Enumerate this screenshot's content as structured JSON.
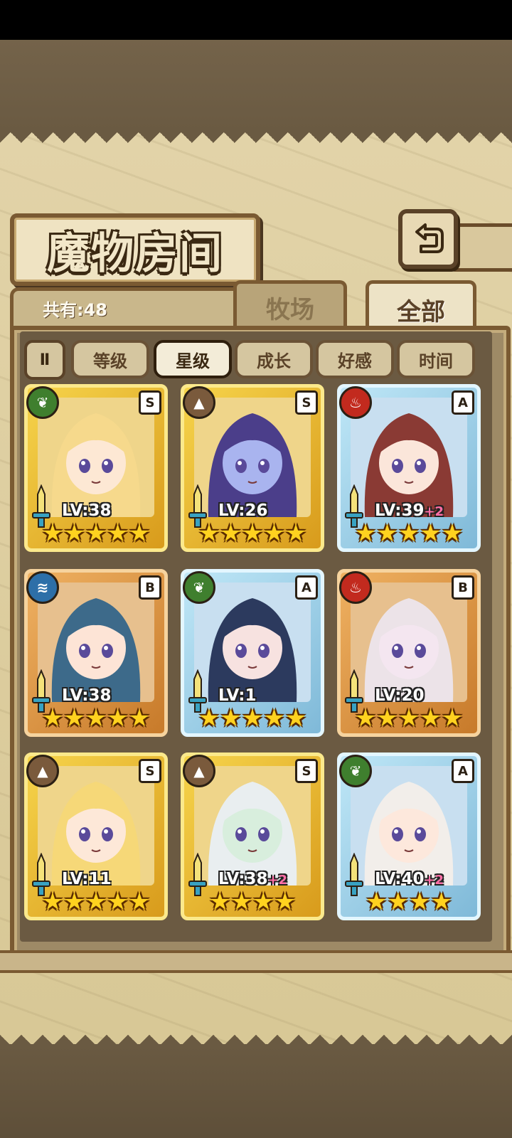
{
  "header": {
    "title": "魔物房间",
    "back_icon": "return-arrow-icon"
  },
  "summary": {
    "count_text": "共有:48"
  },
  "tabs": [
    {
      "label": "牧场",
      "active": false
    },
    {
      "label": "全部",
      "active": true
    }
  ],
  "sort": {
    "toggle_label": "Ⅱ",
    "buttons": [
      {
        "label": "等级",
        "active": false
      },
      {
        "label": "星级",
        "active": true
      },
      {
        "label": "成长",
        "active": false
      },
      {
        "label": "好感",
        "active": false
      },
      {
        "label": "时间",
        "active": false
      }
    ]
  },
  "monsters": [
    {
      "level": "LV:38",
      "plus": "",
      "rank": "S",
      "element": "wood",
      "frame": "gold",
      "stars": 5,
      "hair": "#f6d98c",
      "skin": "#fde8d4"
    },
    {
      "level": "LV:26",
      "plus": "",
      "rank": "S",
      "element": "earth",
      "frame": "gold",
      "stars": 5,
      "hair": "#4b3e8a",
      "skin": "#a9b4ef"
    },
    {
      "level": "LV:39",
      "plus": "+2",
      "rank": "A",
      "element": "fire",
      "frame": "blue",
      "stars": 5,
      "hair": "#8a3a34",
      "skin": "#fbe6da"
    },
    {
      "level": "LV:38",
      "plus": "",
      "rank": "B",
      "element": "water",
      "frame": "bronze",
      "stars": 5,
      "hair": "#3d6a8a",
      "skin": "#fde4d6"
    },
    {
      "level": "LV:1",
      "plus": "",
      "rank": "A",
      "element": "wood",
      "frame": "blue",
      "stars": 5,
      "hair": "#2c3a5e",
      "skin": "#f7e2e0"
    },
    {
      "level": "LV:20",
      "plus": "",
      "rank": "B",
      "element": "fire",
      "frame": "bronze",
      "stars": 5,
      "hair": "#ece3e8",
      "skin": "#f4e6f0"
    },
    {
      "level": "LV:11",
      "plus": "",
      "rank": "S",
      "element": "earth",
      "frame": "gold",
      "stars": 5,
      "hair": "#f6d878",
      "skin": "#fde8d8"
    },
    {
      "level": "LV:38",
      "plus": "+2",
      "rank": "S",
      "element": "earth",
      "frame": "gold",
      "stars": 4,
      "hair": "#e9eef0",
      "skin": "#d8eedd"
    },
    {
      "level": "LV:40",
      "plus": "+2",
      "rank": "A",
      "element": "wood",
      "frame": "blue",
      "stars": 4,
      "hair": "#f2eeea",
      "skin": "#fde8dc"
    }
  ]
}
